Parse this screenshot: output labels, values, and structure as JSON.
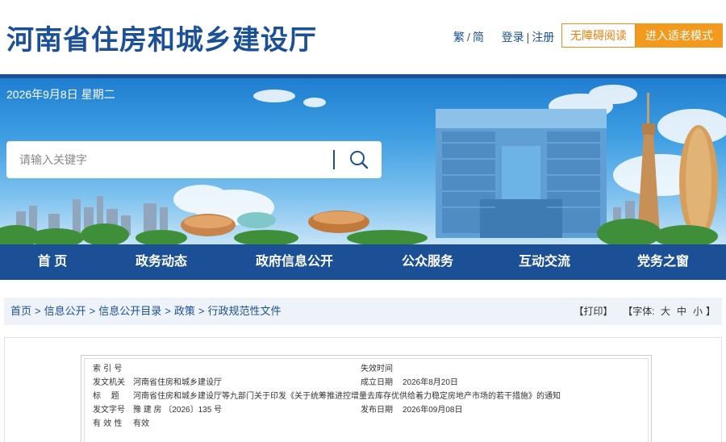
{
  "header": {
    "site_title": "河南省住房和城乡建设厅",
    "lang_traditional": "繁",
    "lang_simplified": "简",
    "login": "登录",
    "register": "注册",
    "accessible_reading": "无障碍阅读",
    "elder_mode": "进入适老模式"
  },
  "banner": {
    "date": "2026年9月8日 星期二",
    "search_placeholder": "请输入关键字"
  },
  "nav": {
    "items": [
      "首 页",
      "政务动态",
      "政府信息公开",
      "公众服务",
      "互动交流",
      "党务之窗"
    ]
  },
  "breadcrumb": {
    "items": [
      "首页",
      "信息公开",
      "信息公开目录",
      "政策",
      "行政规范性文件"
    ],
    "separator": ">",
    "print": "【打印】",
    "font_label": "【字体:",
    "font_large": "大",
    "font_medium": "中",
    "font_small": "小",
    "font_close": "】"
  },
  "document_meta": {
    "index_label": "索 引 号",
    "index_value": "",
    "expire_label": "失效时间",
    "expire_value": "",
    "issuer_label": "发文机关",
    "issuer_value": "河南省住房和城乡建设厅",
    "created_label": "成立日期",
    "created_value": "2026年8月20日",
    "title_label": "标    题",
    "title_value": "河南省住房和城乡建设厅等九部门关于印发《关于统筹推进控增量去库存优供给着力稳定房地产市场的若干措施》的通知",
    "docno_label": "发文字号",
    "docno_value": "豫 建 房 〔2026〕135 号",
    "publish_label": "发布日期",
    "publish_value": "2026年09月08日",
    "validity_label": "有 效 性",
    "validity_value": "有效"
  },
  "colors": {
    "brand_blue": "#1b4f96",
    "accent_orange": "#f39a1e"
  }
}
